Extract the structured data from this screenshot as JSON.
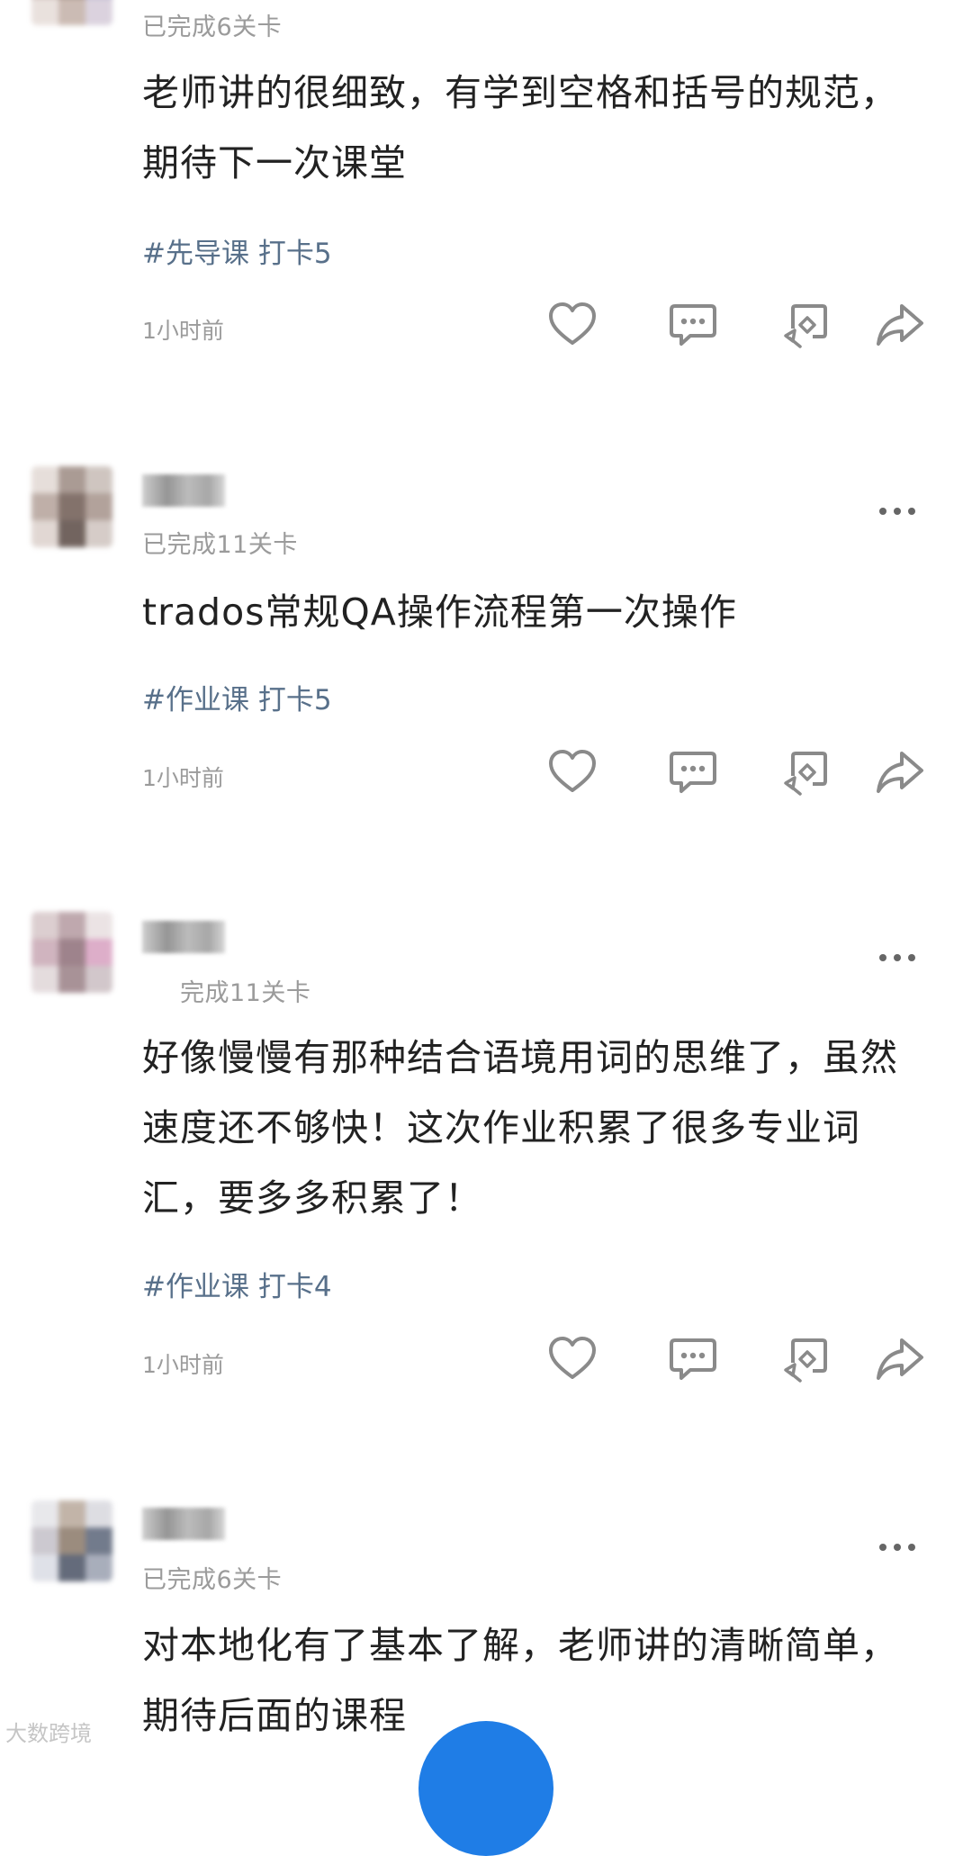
{
  "posts": [
    {
      "progress": "已完成6关卡",
      "content": "老师讲的很细致，有学到空格和括号的规范，期待下一次课堂",
      "tag": "#先导课 打卡5",
      "time": "1小时前"
    },
    {
      "progress": "已完成11关卡",
      "content": "trados常规QA操作流程第一次操作",
      "tag": "#作业课 打卡5",
      "time": "1小时前"
    },
    {
      "progress": "完成11关卡",
      "content": "好像慢慢有那种结合语境用词的思维了，虽然速度还不够快！这次作业积累了很多专业词汇，要多多积累了！",
      "tag": "#作业课 打卡4",
      "time": "1小时前"
    },
    {
      "progress": "已完成6关卡",
      "content": "对本地化有了基本了解，老师讲的清晰简单，期待后面的课程",
      "tag": "",
      "time": ""
    }
  ],
  "watermark": "大数跨境",
  "icons": {
    "like": "heart-icon",
    "comment": "comment-bubble-icon",
    "repost": "repost-icon",
    "share": "share-arrow-icon",
    "more": "more-dots-icon"
  },
  "colors": {
    "tag": "#58708a",
    "meta": "#9b9b9b",
    "icon": "#8a8a8a",
    "fab": "#1f7de6"
  }
}
